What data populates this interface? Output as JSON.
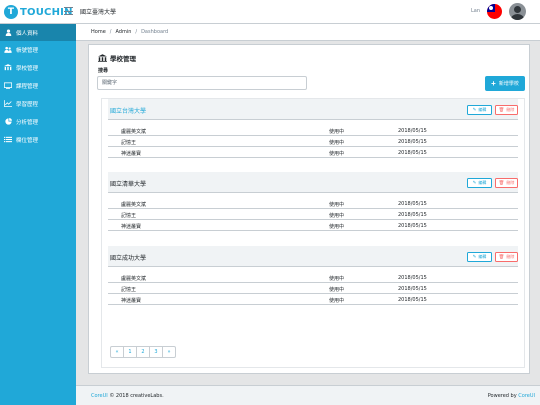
{
  "header": {
    "brand_mark": "T",
    "brand_text": "TOUCHIN",
    "app_title": "國立臺灣大學",
    "user_name": "Lan",
    "flag_icon": "taiwan-flag",
    "avatar_icon": "user-avatar"
  },
  "sidebar": {
    "items": [
      {
        "label": "個人資料",
        "icon": "user-icon",
        "active": true
      },
      {
        "label": "帳號管理",
        "icon": "users-icon",
        "active": false
      },
      {
        "label": "學校管理",
        "icon": "school-icon",
        "active": false
      },
      {
        "label": "課程管理",
        "icon": "book-icon",
        "active": false
      },
      {
        "label": "學習歷程",
        "icon": "chart-line-icon",
        "active": false
      },
      {
        "label": "分析管理",
        "icon": "pie-chart-icon",
        "active": false
      },
      {
        "label": "欄位管理",
        "icon": "list-icon",
        "active": false
      }
    ]
  },
  "breadcrumb": {
    "items": [
      "Home",
      "Admin",
      "Dashboard"
    ]
  },
  "main": {
    "title": "學校管理",
    "search_label": "搜尋",
    "search_placeholder": "關鍵字",
    "add_button": "新增學校",
    "edit_label": "編輯",
    "delete_label": "刪除",
    "schools": [
      {
        "name": "國立台灣大學",
        "highlight": true,
        "members": [
          {
            "name": "盧麗英文斌",
            "status": "使用中",
            "date": "2018/05/15"
          },
          {
            "name": "記憶王",
            "status": "使用中",
            "date": "2018/05/15"
          },
          {
            "name": "神迷叢寶",
            "status": "使用中",
            "date": "2018/05/15"
          }
        ]
      },
      {
        "name": "國立清華大學",
        "highlight": false,
        "members": [
          {
            "name": "盧麗英文斌",
            "status": "使用中",
            "date": "2018/05/15"
          },
          {
            "name": "記憶王",
            "status": "使用中",
            "date": "2018/05/15"
          },
          {
            "name": "神迷叢寶",
            "status": "使用中",
            "date": "2018/05/15"
          }
        ]
      },
      {
        "name": "國立成功大學",
        "highlight": false,
        "members": [
          {
            "name": "盧麗英文斌",
            "status": "使用中",
            "date": "2018/05/15"
          },
          {
            "name": "記憶王",
            "status": "使用中",
            "date": "2018/05/15"
          },
          {
            "name": "神迷叢寶",
            "status": "使用中",
            "date": "2018/05/15"
          }
        ]
      }
    ],
    "pagination": [
      "«",
      "1",
      "2",
      "3",
      "»"
    ]
  },
  "footer": {
    "left_link": "CoreUI",
    "left_text": "© 2018 creativeLabs.",
    "right_text": "Powered by",
    "right_link": "CoreUI"
  },
  "colors": {
    "primary": "#20a8d8",
    "primary_dark": "#1985ac",
    "danger": "#f86c6b",
    "body_bg": "#e4e5e6"
  }
}
